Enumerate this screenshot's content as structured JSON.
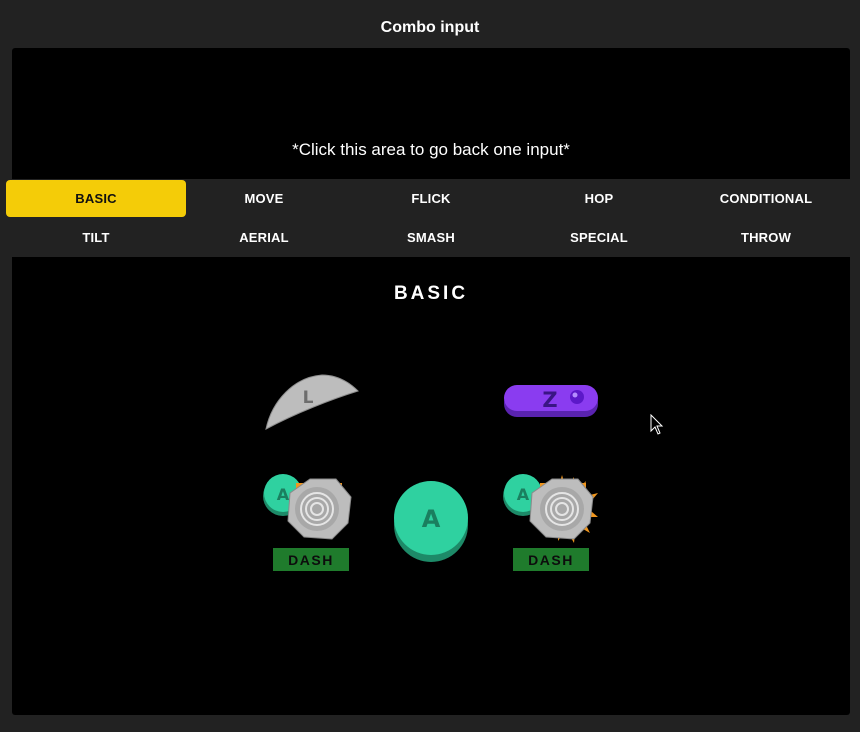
{
  "header": {
    "title": "Combo input"
  },
  "back_area": {
    "hint": "*Click this area to go back one input*"
  },
  "tabs": [
    {
      "label": "BASIC"
    },
    {
      "label": "MOVE"
    },
    {
      "label": "FLICK"
    },
    {
      "label": "HOP"
    },
    {
      "label": "CONDITIONAL"
    },
    {
      "label": "TILT"
    },
    {
      "label": "AERIAL"
    },
    {
      "label": "SMASH"
    },
    {
      "label": "SPECIAL"
    },
    {
      "label": "THROW"
    }
  ],
  "active_tab": "BASIC",
  "panel": {
    "title": "BASIC",
    "buttons": {
      "l_trigger": {
        "letter": "L",
        "icon": "l-trigger-icon"
      },
      "z_button": {
        "letter": "Z",
        "icon": "z-button-icon"
      },
      "a_button": {
        "letter": "A",
        "icon": "a-button-icon"
      },
      "dash_left": {
        "letter": "A",
        "label": "DASH",
        "icon": "dash-left-icon"
      },
      "dash_right": {
        "letter": "A",
        "label": "DASH",
        "icon": "dash-right-icon"
      }
    }
  },
  "colors": {
    "accent": "#f4cc08",
    "a_button": "#2fd1a0",
    "z_button": "#8a3cf0",
    "dash_bg": "#1f7b2c",
    "panel_bg": "#000000",
    "page_bg": "#222222"
  }
}
